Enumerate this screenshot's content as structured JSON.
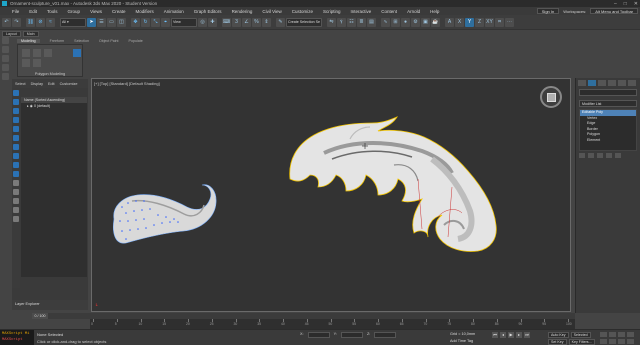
{
  "window": {
    "title": "Ornament-sculpture_v01.max - Autodesk 3ds Max 2020 - Student Version",
    "controls": [
      "–",
      "□",
      "✕"
    ]
  },
  "menu": {
    "items": [
      "File",
      "Edit",
      "Tools",
      "Group",
      "Views",
      "Create",
      "Modifiers",
      "Animation",
      "Graph Editors",
      "Rendering",
      "Civil View",
      "Customize",
      "Scripting",
      "Interactive",
      "Content",
      "Arnold",
      "Help"
    ],
    "sign_in": "Sign In",
    "workspaces_label": "Workspaces:",
    "workspace_value": "Alt Menu and Toolbar"
  },
  "toolbar": {
    "selection_set_placeholder": "Create Selection Se",
    "view_dropdown": "View"
  },
  "ribbon": {
    "tabs": [
      "Modeling",
      "Freeform",
      "Selection",
      "Object Paint",
      "Populate"
    ],
    "active_tab": "Modeling",
    "panel_label": "Polygon Modeling",
    "file_tab_1": "Layout",
    "file_tab_2": "Main"
  },
  "explorer": {
    "tabs": [
      "Select",
      "Display",
      "Edit",
      "Customize"
    ],
    "header": "Name (Sorted Ascending)",
    "row_default": "0 (default)",
    "layer_label": "Layer Explorer"
  },
  "viewport": {
    "label": "[+] [Top] [Standard] [Default Shading]"
  },
  "command_panel": {
    "modifier_list": "Modifier List",
    "stack": [
      "Editable Poly",
      "Vertex",
      "Edge",
      "Border",
      "Polygon",
      "Element"
    ]
  },
  "timeline": {
    "position": "0 / 100",
    "ticks": [
      "0",
      "5",
      "10",
      "15",
      "20",
      "25",
      "30",
      "35",
      "40",
      "45",
      "50",
      "55",
      "60",
      "65",
      "70",
      "75",
      "80",
      "85",
      "90",
      "95",
      "100"
    ]
  },
  "status": {
    "maxscript_1": "MAXScript Mi",
    "maxscript_2": "MAXScript",
    "selection": "None Selected",
    "hint": "Click or click-and-drag to select objects",
    "grid": "Grid = 10,0mm",
    "add_time_tag": "Add Time Tag",
    "auto_key": "Auto Key",
    "selected": "Selected",
    "set_key": "Set Key",
    "key_filters": "Key Filters..."
  }
}
